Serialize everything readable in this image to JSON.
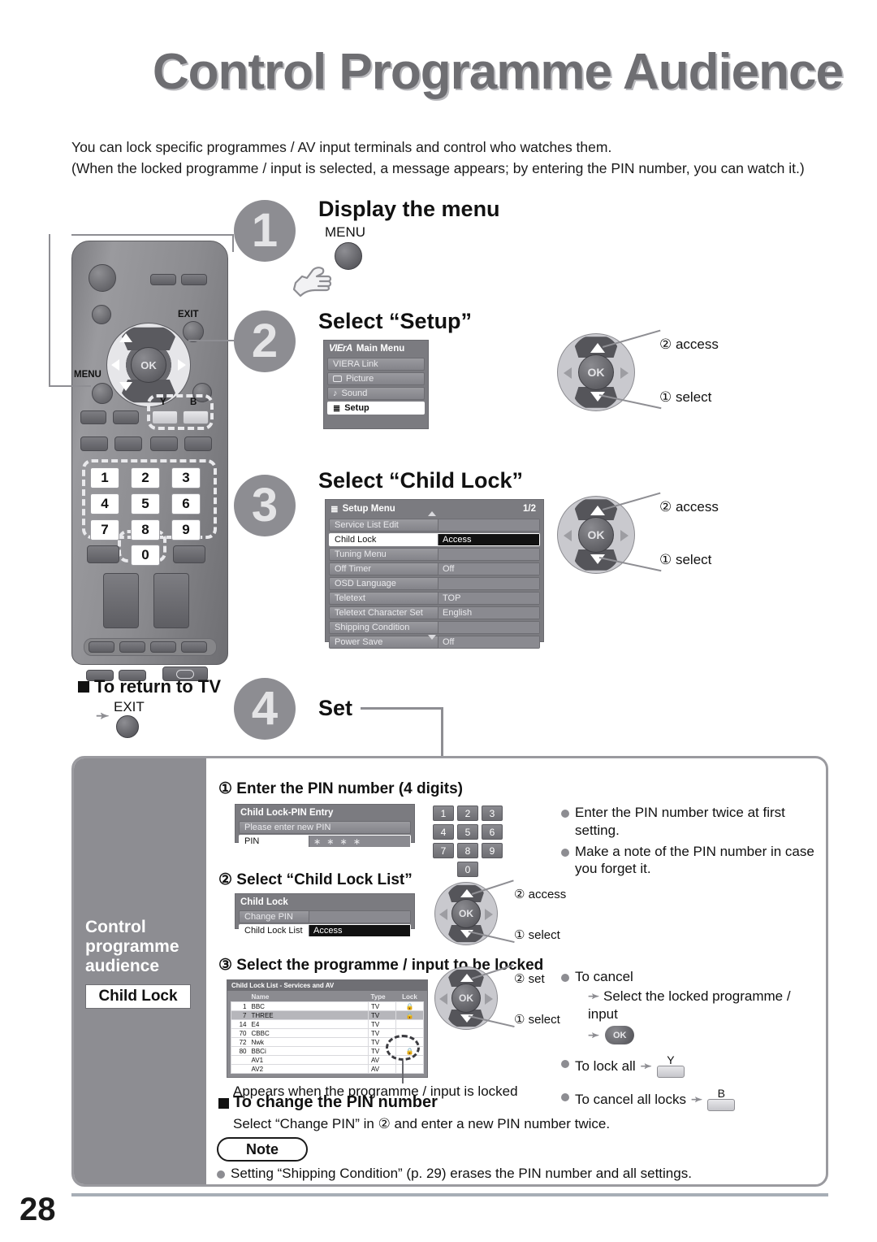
{
  "page": {
    "title": "Control Programme Audience",
    "intro": "You can lock specific programmes / AV input terminals and control who watches them.\n(When the locked programme / input is selected, a message appears; by entering the PIN number, you can watch it.)",
    "number": "28"
  },
  "steps": [
    {
      "num": "1",
      "title": "Display the menu",
      "button_label": "MENU"
    },
    {
      "num": "2",
      "title": "Select “Setup”"
    },
    {
      "num": "3",
      "title": "Select “Child Lock”"
    },
    {
      "num": "4",
      "title": "Set"
    }
  ],
  "return_to_tv": {
    "heading": "To return to TV",
    "button_label": "EXIT"
  },
  "main_menu": {
    "brand": "VIErA",
    "title": "Main Menu",
    "items": [
      {
        "label": "VIERA Link",
        "icon": "",
        "selected": false
      },
      {
        "label": "Picture",
        "icon": "picture-icon",
        "selected": false
      },
      {
        "label": "Sound",
        "icon": "note-icon",
        "selected": false
      },
      {
        "label": "Setup",
        "icon": "list-icon",
        "selected": true
      }
    ]
  },
  "setup_menu": {
    "title": "Setup Menu",
    "page_indicator": "1/2",
    "rows": [
      {
        "label": "Service List Edit",
        "value": "",
        "selected": false
      },
      {
        "label": "Child Lock",
        "value": "Access",
        "selected": true
      },
      {
        "label": "Tuning Menu",
        "value": "",
        "selected": false
      },
      {
        "label": "Off Timer",
        "value": "Off",
        "selected": false
      },
      {
        "label": "OSD Language",
        "value": "",
        "selected": false
      },
      {
        "label": "Teletext",
        "value": "TOP",
        "selected": false
      },
      {
        "label": "Teletext Character Set",
        "value": "English",
        "selected": false
      },
      {
        "label": "Shipping Condition",
        "value": "",
        "selected": false
      },
      {
        "label": "Power Save",
        "value": "Off",
        "selected": false
      }
    ]
  },
  "nav_hints": {
    "setup": {
      "top": "② access",
      "bottom": "① select"
    },
    "childlock": {
      "top": "② access",
      "bottom": "① select"
    },
    "list_access": {
      "top": "② access",
      "bottom": "① select"
    },
    "list_set": {
      "top": "② set",
      "bottom": "① select"
    }
  },
  "sidebar": {
    "heading": "Control\nprogramme\naudience",
    "chip": "Child Lock"
  },
  "substep1": {
    "heading": "① Enter the PIN number (4 digits)",
    "dialog": {
      "title": "Child Lock-PIN Entry",
      "message": "Please enter new PIN",
      "field_label": "PIN",
      "field_value": "∗ ∗ ∗ ∗"
    },
    "keypad": [
      "1",
      "2",
      "3",
      "4",
      "5",
      "6",
      "7",
      "8",
      "9",
      "0"
    ],
    "notes": [
      "Enter the PIN number twice at first setting.",
      "Make a note of the PIN number in case you forget it."
    ]
  },
  "substep2": {
    "heading": "② Select “Child Lock List”",
    "dialog": {
      "title": "Child Lock",
      "rows": [
        {
          "label": "Change PIN",
          "value": "",
          "selected": false
        },
        {
          "label": "Child Lock List",
          "value": "Access",
          "selected": true
        }
      ]
    }
  },
  "substep3": {
    "heading": "③ Select the programme / input to be locked",
    "table": {
      "title": "Child Lock List - Services and AV",
      "headers": [
        "Name",
        "Type",
        "Lock"
      ],
      "rows": [
        {
          "num": "1",
          "name": "BBC",
          "type": "TV",
          "lock": "🔒",
          "highlight": false
        },
        {
          "num": "7",
          "name": "THREE",
          "type": "TV",
          "lock": "🔒",
          "highlight": true
        },
        {
          "num": "14",
          "name": "E4",
          "type": "TV",
          "lock": "",
          "highlight": false
        },
        {
          "num": "70",
          "name": "CBBC",
          "type": "TV",
          "lock": "",
          "highlight": false
        },
        {
          "num": "72",
          "name": "Nwk",
          "type": "TV",
          "lock": "",
          "highlight": false
        },
        {
          "num": "80",
          "name": "BBCi",
          "type": "TV",
          "lock": "🔒",
          "highlight": false
        },
        {
          "num": "",
          "name": "AV1",
          "type": "AV",
          "lock": "",
          "highlight": false
        },
        {
          "num": "",
          "name": "AV2",
          "type": "AV",
          "lock": "",
          "highlight": false
        }
      ]
    },
    "caption": "Appears when the programme / input is locked",
    "notes": {
      "cancel_title": "To cancel",
      "cancel_step1": "Select the locked programme / input",
      "cancel_step2_button": "OK",
      "lock_all": "To lock all",
      "lock_all_button": "Y",
      "cancel_all": "To cancel all locks",
      "cancel_all_button": "B"
    }
  },
  "change_pin": {
    "heading": "To change the PIN number",
    "body": "Select “Change PIN” in ② and enter a new PIN number twice."
  },
  "note": {
    "label": "Note",
    "items": [
      "Setting “Shipping Condition” (p. 29) erases the PIN number and all settings."
    ]
  },
  "remote": {
    "menu_label": "MENU",
    "exit_label": "EXIT",
    "ok_label": "OK",
    "color_y": "Y",
    "color_b": "B",
    "numbers": [
      "1",
      "2",
      "3",
      "4",
      "5",
      "6",
      "7",
      "8",
      "9",
      "0"
    ]
  }
}
